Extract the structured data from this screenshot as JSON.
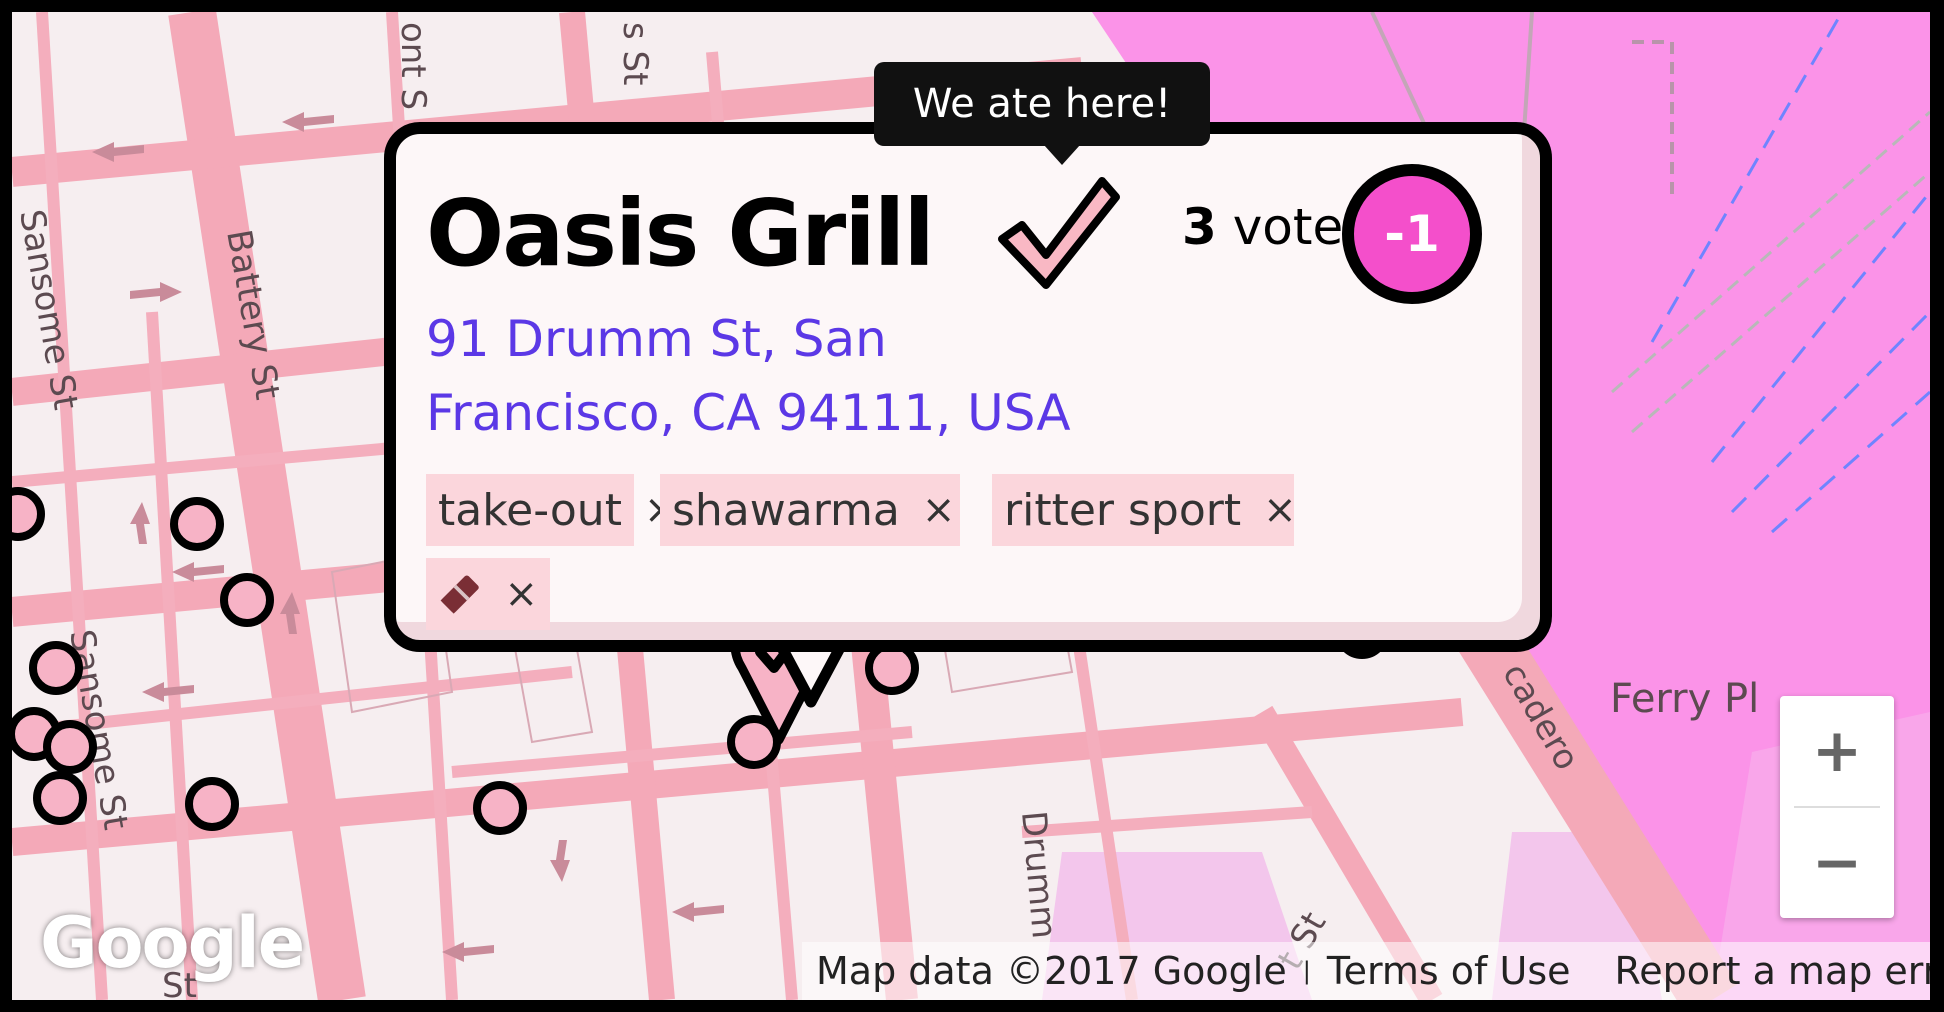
{
  "popup": {
    "tooltip": "We ate here!",
    "title": "Oasis Grill",
    "votes_count": "3",
    "votes_label": "votes",
    "vote_button": "-1",
    "address_line1": "91 Drumm St, San",
    "address_line2": "Francisco, CA 94111, USA",
    "tags": [
      {
        "label": "take-out",
        "remove": "×"
      },
      {
        "label": "shawarma",
        "remove": "×"
      },
      {
        "label": "ritter sport",
        "remove": "×"
      },
      {
        "label": "",
        "remove": "×",
        "icon": "chocolate-bar-icon"
      }
    ]
  },
  "map": {
    "street_labels": [
      "ont S",
      "s St",
      "Sansome St",
      "Battery St",
      "Sansome St",
      "St",
      "Drumm",
      "cadero",
      "Ferry Pl",
      "t St",
      "St"
    ],
    "zoom_in": "+",
    "zoom_out": "−",
    "logo": "Google",
    "footer": {
      "map_data": "Map data ©2017 Google",
      "terms": "Terms of Use",
      "report": "Report a map error"
    }
  },
  "colors": {
    "accent": "#f44fcb",
    "address_link": "#5b38e6",
    "tag_bg": "#fbd6dc",
    "marker_fill": "#f7b3c6",
    "water": "#fb93e8",
    "road": "#f4a9b8"
  }
}
